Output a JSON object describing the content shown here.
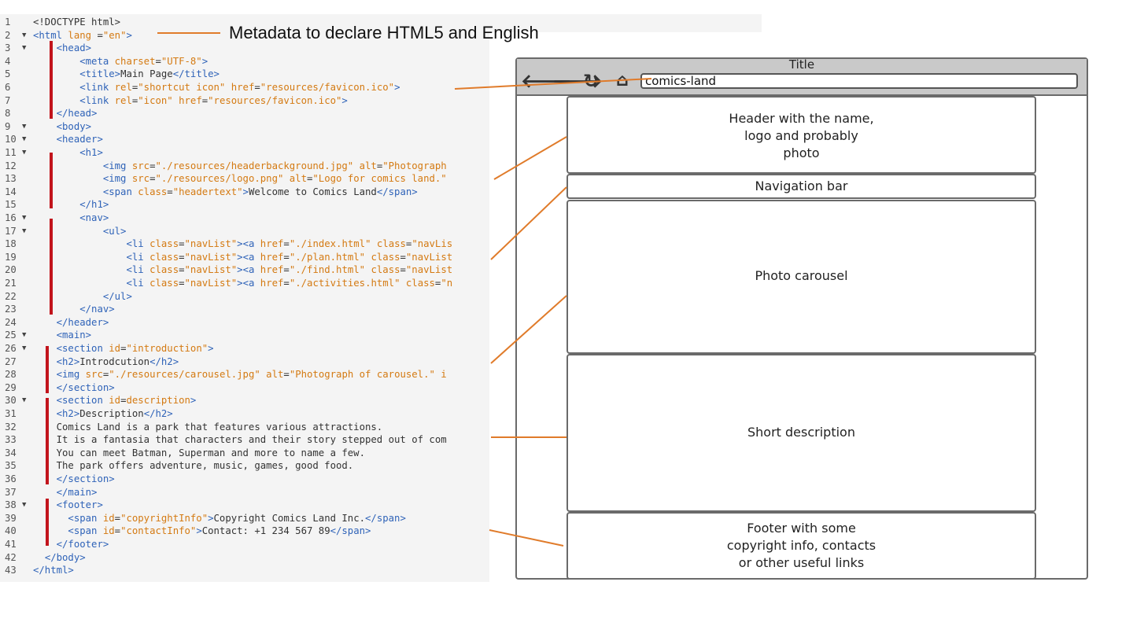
{
  "code": {
    "lines": [
      {
        "n": "1",
        "f": "",
        "parts": [
          [
            "txt",
            "<!DOCTYPE html>"
          ]
        ]
      },
      {
        "n": "2",
        "f": "▼",
        "parts": [
          [
            "tag",
            "<html "
          ],
          [
            "attr",
            "lang "
          ],
          [
            "txt",
            "="
          ],
          [
            "str",
            "\"en\""
          ],
          [
            "tag",
            ">"
          ]
        ]
      },
      {
        "n": "3",
        "f": "▼",
        "parts": [
          [
            "txt",
            "    "
          ],
          [
            "tag",
            "<head>"
          ]
        ]
      },
      {
        "n": "4",
        "f": "",
        "parts": [
          [
            "txt",
            "        "
          ],
          [
            "tag",
            "<meta "
          ],
          [
            "attr",
            "charset"
          ],
          [
            "txt",
            "="
          ],
          [
            "str",
            "\"UTF-8\""
          ],
          [
            "tag",
            ">"
          ]
        ]
      },
      {
        "n": "5",
        "f": "",
        "parts": [
          [
            "txt",
            "        "
          ],
          [
            "tag",
            "<title>"
          ],
          [
            "txt",
            "Main Page"
          ],
          [
            "tag",
            "</title>"
          ]
        ]
      },
      {
        "n": "6",
        "f": "",
        "parts": [
          [
            "txt",
            "        "
          ],
          [
            "tag",
            "<link "
          ],
          [
            "attr",
            "rel"
          ],
          [
            "txt",
            "="
          ],
          [
            "str",
            "\"shortcut icon\""
          ],
          [
            "attr",
            " href"
          ],
          [
            "txt",
            "="
          ],
          [
            "str",
            "\"resources/favicon.ico\""
          ],
          [
            "tag",
            ">"
          ]
        ]
      },
      {
        "n": "7",
        "f": "",
        "parts": [
          [
            "txt",
            "        "
          ],
          [
            "tag",
            "<link "
          ],
          [
            "attr",
            "rel"
          ],
          [
            "txt",
            "="
          ],
          [
            "str",
            "\"icon\""
          ],
          [
            "attr",
            " href"
          ],
          [
            "txt",
            "="
          ],
          [
            "str",
            "\"resources/favicon.ico\""
          ],
          [
            "tag",
            ">"
          ]
        ]
      },
      {
        "n": "8",
        "f": "",
        "parts": [
          [
            "txt",
            "    "
          ],
          [
            "tag",
            "</head>"
          ]
        ]
      },
      {
        "n": "9",
        "f": "▼",
        "parts": [
          [
            "txt",
            "    "
          ],
          [
            "tag",
            "<body>"
          ]
        ]
      },
      {
        "n": "10",
        "f": "▼",
        "parts": [
          [
            "txt",
            "    "
          ],
          [
            "tag",
            "<header>"
          ]
        ]
      },
      {
        "n": "11",
        "f": "▼",
        "parts": [
          [
            "txt",
            "        "
          ],
          [
            "tag",
            "<h1>"
          ]
        ]
      },
      {
        "n": "12",
        "f": "",
        "parts": [
          [
            "txt",
            "            "
          ],
          [
            "tag",
            "<img "
          ],
          [
            "attr",
            "src"
          ],
          [
            "txt",
            "="
          ],
          [
            "str",
            "\"./resources/headerbackground.jpg\""
          ],
          [
            "attr",
            " alt"
          ],
          [
            "txt",
            "="
          ],
          [
            "str",
            "\"Photograph"
          ]
        ]
      },
      {
        "n": "13",
        "f": "",
        "parts": [
          [
            "txt",
            "            "
          ],
          [
            "tag",
            "<img "
          ],
          [
            "attr",
            "src"
          ],
          [
            "txt",
            "="
          ],
          [
            "str",
            "\"./resources/logo.png\""
          ],
          [
            "attr",
            " alt"
          ],
          [
            "txt",
            "="
          ],
          [
            "str",
            "\"Logo for comics land.\""
          ]
        ]
      },
      {
        "n": "14",
        "f": "",
        "parts": [
          [
            "txt",
            "            "
          ],
          [
            "tag",
            "<span "
          ],
          [
            "attr",
            "class"
          ],
          [
            "txt",
            "="
          ],
          [
            "str",
            "\"headertext\""
          ],
          [
            "tag",
            ">"
          ],
          [
            "txt",
            "Welcome to Comics Land"
          ],
          [
            "tag",
            "</span>"
          ]
        ]
      },
      {
        "n": "15",
        "f": "",
        "parts": [
          [
            "txt",
            "        "
          ],
          [
            "tag",
            "</h1>"
          ]
        ]
      },
      {
        "n": "16",
        "f": "▼",
        "parts": [
          [
            "txt",
            "        "
          ],
          [
            "tag",
            "<nav>"
          ]
        ]
      },
      {
        "n": "17",
        "f": "▼",
        "parts": [
          [
            "txt",
            "            "
          ],
          [
            "tag",
            "<ul>"
          ]
        ]
      },
      {
        "n": "18",
        "f": "",
        "parts": [
          [
            "txt",
            "                "
          ],
          [
            "tag",
            "<li "
          ],
          [
            "attr",
            "class"
          ],
          [
            "txt",
            "="
          ],
          [
            "str",
            "\"navList\""
          ],
          [
            "tag",
            "><a "
          ],
          [
            "attr",
            "href"
          ],
          [
            "txt",
            "="
          ],
          [
            "str",
            "\"./index.html\""
          ],
          [
            "attr",
            " class"
          ],
          [
            "txt",
            "="
          ],
          [
            "str",
            "\"navLis"
          ]
        ]
      },
      {
        "n": "19",
        "f": "",
        "parts": [
          [
            "txt",
            "                "
          ],
          [
            "tag",
            "<li "
          ],
          [
            "attr",
            "class"
          ],
          [
            "txt",
            "="
          ],
          [
            "str",
            "\"navList\""
          ],
          [
            "tag",
            "><a "
          ],
          [
            "attr",
            "href"
          ],
          [
            "txt",
            "="
          ],
          [
            "str",
            "\"./plan.html\""
          ],
          [
            "attr",
            " class"
          ],
          [
            "txt",
            "="
          ],
          [
            "str",
            "\"navList"
          ]
        ]
      },
      {
        "n": "20",
        "f": "",
        "parts": [
          [
            "txt",
            "                "
          ],
          [
            "tag",
            "<li "
          ],
          [
            "attr",
            "class"
          ],
          [
            "txt",
            "="
          ],
          [
            "str",
            "\"navList\""
          ],
          [
            "tag",
            "><a "
          ],
          [
            "attr",
            "href"
          ],
          [
            "txt",
            "="
          ],
          [
            "str",
            "\"./find.html\""
          ],
          [
            "attr",
            " class"
          ],
          [
            "txt",
            "="
          ],
          [
            "str",
            "\"navList"
          ]
        ]
      },
      {
        "n": "21",
        "f": "",
        "parts": [
          [
            "txt",
            "                "
          ],
          [
            "tag",
            "<li "
          ],
          [
            "attr",
            "class"
          ],
          [
            "txt",
            "="
          ],
          [
            "str",
            "\"navList\""
          ],
          [
            "tag",
            "><a "
          ],
          [
            "attr",
            "href"
          ],
          [
            "txt",
            "="
          ],
          [
            "str",
            "\"./activities.html\""
          ],
          [
            "attr",
            " class"
          ],
          [
            "txt",
            "="
          ],
          [
            "str",
            "\"n"
          ]
        ]
      },
      {
        "n": "22",
        "f": "",
        "parts": [
          [
            "txt",
            "            "
          ],
          [
            "tag",
            "</ul>"
          ]
        ]
      },
      {
        "n": "23",
        "f": "",
        "parts": [
          [
            "txt",
            "        "
          ],
          [
            "tag",
            "</nav>"
          ]
        ]
      },
      {
        "n": "24",
        "f": "",
        "parts": [
          [
            "txt",
            "    "
          ],
          [
            "tag",
            "</header>"
          ]
        ]
      },
      {
        "n": "25",
        "f": "▼",
        "parts": [
          [
            "txt",
            "    "
          ],
          [
            "tag",
            "<main>"
          ]
        ]
      },
      {
        "n": "26",
        "f": "▼",
        "parts": [
          [
            "txt",
            "    "
          ],
          [
            "tag",
            "<section "
          ],
          [
            "attr",
            "id"
          ],
          [
            "txt",
            "="
          ],
          [
            "str",
            "\"introduction\""
          ],
          [
            "tag",
            ">"
          ]
        ]
      },
      {
        "n": "27",
        "f": "",
        "parts": [
          [
            "txt",
            "    "
          ],
          [
            "tag",
            "<h2>"
          ],
          [
            "txt",
            "Introdcution"
          ],
          [
            "tag",
            "</h2>"
          ]
        ]
      },
      {
        "n": "28",
        "f": "",
        "parts": [
          [
            "txt",
            "    "
          ],
          [
            "tag",
            "<img "
          ],
          [
            "attr",
            "src"
          ],
          [
            "txt",
            "="
          ],
          [
            "str",
            "\"./resources/carousel.jpg\""
          ],
          [
            "attr",
            " alt"
          ],
          [
            "txt",
            "="
          ],
          [
            "str",
            "\"Photograph of carousel.\""
          ],
          [
            "attr",
            " i"
          ]
        ]
      },
      {
        "n": "29",
        "f": "",
        "parts": [
          [
            "txt",
            "    "
          ],
          [
            "tag",
            "</section>"
          ]
        ]
      },
      {
        "n": "30",
        "f": "▼",
        "parts": [
          [
            "txt",
            "    "
          ],
          [
            "tag",
            "<section "
          ],
          [
            "attr",
            "id"
          ],
          [
            "txt",
            "="
          ],
          [
            "str",
            "description"
          ],
          [
            "tag",
            ">"
          ]
        ]
      },
      {
        "n": "31",
        "f": "",
        "parts": [
          [
            "txt",
            "    "
          ],
          [
            "tag",
            "<h2>"
          ],
          [
            "txt",
            "Description"
          ],
          [
            "tag",
            "</h2>"
          ]
        ]
      },
      {
        "n": "32",
        "f": "",
        "parts": [
          [
            "txt",
            "    Comics Land is a park that features various attractions."
          ]
        ]
      },
      {
        "n": "33",
        "f": "",
        "parts": [
          [
            "txt",
            "    It is a fantasia that characters and their story stepped out of com"
          ]
        ]
      },
      {
        "n": "34",
        "f": "",
        "parts": [
          [
            "txt",
            "    You can meet Batman, Superman and more to name a few."
          ]
        ]
      },
      {
        "n": "35",
        "f": "",
        "parts": [
          [
            "txt",
            "    The park offers adventure, music, games, good food."
          ]
        ]
      },
      {
        "n": "36",
        "f": "",
        "parts": [
          [
            "txt",
            "    "
          ],
          [
            "tag",
            "</section>"
          ]
        ]
      },
      {
        "n": "37",
        "f": "",
        "parts": [
          [
            "txt",
            "    "
          ],
          [
            "tag",
            "</main>"
          ]
        ]
      },
      {
        "n": "38",
        "f": "▼",
        "parts": [
          [
            "txt",
            "    "
          ],
          [
            "tag",
            "<footer>"
          ]
        ]
      },
      {
        "n": "39",
        "f": "",
        "parts": [
          [
            "txt",
            "      "
          ],
          [
            "tag",
            "<span "
          ],
          [
            "attr",
            "id"
          ],
          [
            "txt",
            "="
          ],
          [
            "str",
            "\"copyrightInfo\""
          ],
          [
            "tag",
            ">"
          ],
          [
            "txt",
            "Copyright Comics Land Inc."
          ],
          [
            "tag",
            "</span>"
          ]
        ]
      },
      {
        "n": "40",
        "f": "",
        "parts": [
          [
            "txt",
            "      "
          ],
          [
            "tag",
            "<span "
          ],
          [
            "attr",
            "id"
          ],
          [
            "txt",
            "="
          ],
          [
            "str",
            "\"contactInfo\""
          ],
          [
            "tag",
            ">"
          ],
          [
            "txt",
            "Contact: +1 234 567 89"
          ],
          [
            "tag",
            "</span>"
          ]
        ]
      },
      {
        "n": "41",
        "f": "",
        "parts": [
          [
            "txt",
            "    "
          ],
          [
            "tag",
            "</footer>"
          ]
        ]
      },
      {
        "n": "42",
        "f": "",
        "parts": [
          [
            "txt",
            "  "
          ],
          [
            "tag",
            "</body>"
          ]
        ]
      },
      {
        "n": "43",
        "f": "",
        "parts": [
          [
            "tag",
            "</html>"
          ]
        ]
      }
    ]
  },
  "annotation": {
    "metadata": "Metadata to declare HTML5 and English"
  },
  "wireframe": {
    "title": "Title",
    "url": "comics-land",
    "icons": [
      "back-arrow-icon",
      "forward-arrow-icon",
      "reload-icon",
      "home-icon"
    ],
    "header": [
      "Header with the name,",
      "logo and probably",
      "photo"
    ],
    "nav": "Navigation bar",
    "carousel": "Photo carousel",
    "description": "Short description",
    "footer": [
      "Footer with some",
      "copyright info, contacts",
      "or other useful links"
    ]
  },
  "colors": {
    "connector": "#e07b2a",
    "marker": "#c2141c",
    "tag": "#2f63b8",
    "attribute": "#d47a12",
    "frame": "#6a6a6a",
    "browser_bar": "#c9c9c9"
  }
}
